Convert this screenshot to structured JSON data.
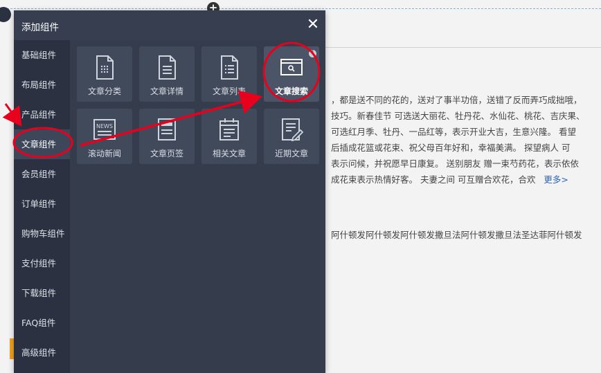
{
  "dialog": {
    "title": "添加组件",
    "close_glyph": "✕"
  },
  "sidebar": {
    "items": [
      {
        "label": "基础组件"
      },
      {
        "label": "布局组件"
      },
      {
        "label": "产品组件"
      },
      {
        "label": "文章组件",
        "active": true
      },
      {
        "label": "会员组件"
      },
      {
        "label": "订单组件"
      },
      {
        "label": "购物车组件"
      },
      {
        "label": "支付组件"
      },
      {
        "label": "下载组件"
      },
      {
        "label": "FAQ组件"
      },
      {
        "label": "高级组件"
      }
    ]
  },
  "tiles": [
    {
      "label": "文章分类",
      "icon": "doc-dots-icon"
    },
    {
      "label": "文章详情",
      "icon": "doc-lines-icon"
    },
    {
      "label": "文章列表",
      "icon": "doc-list-icon"
    },
    {
      "label": "文章搜索",
      "icon": "search-window-icon",
      "selected": true
    },
    {
      "label": "滚动新闻",
      "icon": "news-icon"
    },
    {
      "label": "文章页签",
      "icon": "doc-tab-icon"
    },
    {
      "label": "相关文章",
      "icon": "calendar-doc-icon"
    },
    {
      "label": "近期文章",
      "icon": "doc-pen-icon"
    }
  ],
  "background": {
    "lines": [
      "，都是送不同的花的，送对了事半功倍，送错了反而弄巧成拙哦，",
      "技巧。新春佳节 可选送大丽花、牡丹花、水仙花、桃花、吉庆果、",
      "可选红月季、牡丹、一品红等，表示开业大吉，生意兴隆。 看望",
      "后插成花篮或花束、祝父母百年好和，幸福美满。 探望病人 可",
      "表示问候，并祝愿早日康复。 送别朋友 赠一束芍药花，表示依依",
      "成花束表示热情好客。 夫妻之间 可互赠合欢花，合欢",
      "阿什顿发阿什顿发阿什顿发撒旦法阿什顿发撒旦法圣达菲阿什顿发"
    ],
    "more_link": "更多>"
  },
  "colors": {
    "dialog_bg": "#333b4b",
    "sidebar_bg": "#2b3140",
    "annotation_red": "#e8001c"
  }
}
